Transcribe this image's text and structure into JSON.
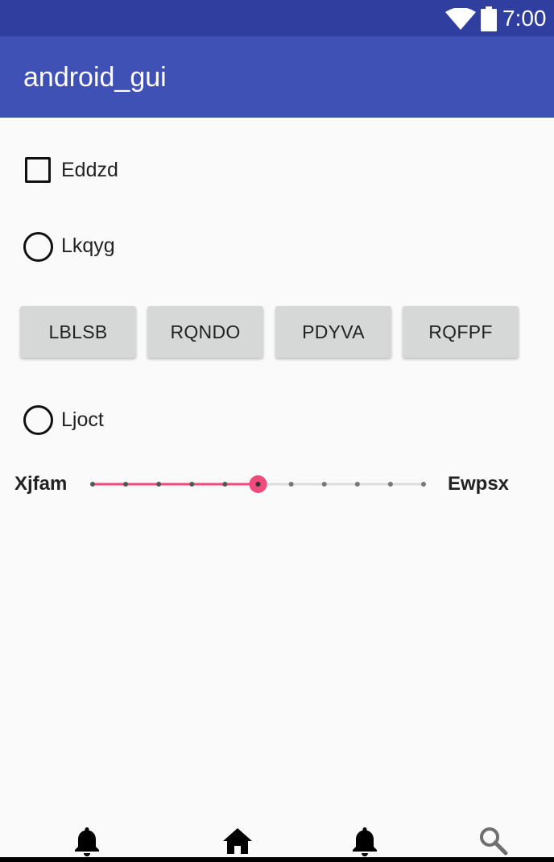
{
  "status_bar": {
    "time": "7:00",
    "icons": [
      "wifi-icon",
      "battery-icon"
    ]
  },
  "app_bar": {
    "title": "android_gui"
  },
  "checkbox": {
    "label": "Eddzd",
    "checked": false
  },
  "radios": [
    {
      "label": "Lkqyg",
      "selected": false
    },
    {
      "label": "Ljoct",
      "selected": false
    }
  ],
  "buttons": [
    {
      "label": "LBLSB"
    },
    {
      "label": "RQNDO"
    },
    {
      "label": "PDYVA"
    },
    {
      "label": "RQFPF"
    }
  ],
  "slider": {
    "left_label": "Xjfam",
    "right_label": "Ewpsx",
    "steps": 10,
    "value": 5,
    "accent_color": "#ef4b7d"
  },
  "bottom_nav": {
    "icons": [
      "bell-icon",
      "home-icon",
      "bell-icon",
      "search-icon"
    ]
  },
  "colors": {
    "status_bar": "#303f9f",
    "app_bar": "#3f51b5",
    "background": "#fafafa",
    "button": "#d6d7d7"
  }
}
